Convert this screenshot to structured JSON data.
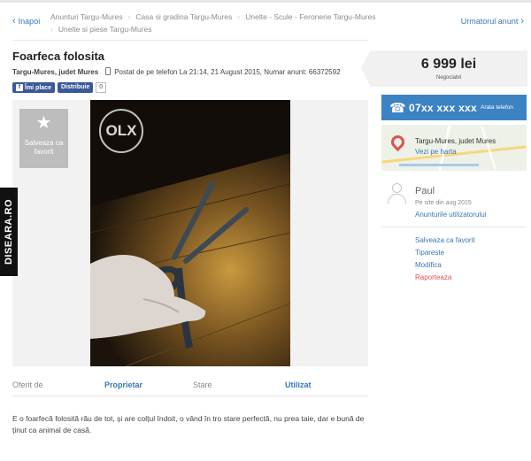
{
  "nav": {
    "back_label": "Inapoi",
    "next_label": "Urmatorul anunt",
    "breadcrumbs": [
      "Anunturi Targu-Mures",
      "Casa si gradina Targu-Mures",
      "Unelte - Scule - Feronerie Targu-Mures",
      "Unelte si piese Targu-Mures"
    ]
  },
  "listing": {
    "title": "Foarfeca folosita",
    "location": "Targu-Mures, judet Mures",
    "posted": "Postat de pe telefon La 21:14, 21 August 2015, Numar anunt: 66372592",
    "like_label": "Îmi place",
    "share_label": "Distribuie",
    "share_count": "0",
    "save_label": "Salveaza ca favorit",
    "photo_logo": "OLX",
    "details": [
      {
        "key": "Oferit de",
        "value": "Proprietar"
      },
      {
        "key": "Stare",
        "value": "Utilizat"
      }
    ],
    "description": "E o foarfecă folosită rău de tot, și are colțul îndoit, o vând în tro stare perfectă, nu prea taie, dar e bună de ținut ca animal de casă."
  },
  "sidebar": {
    "price": "6 999 lei",
    "negotiable": "Negociabil",
    "phone": "07xx xxx xxx",
    "phone_show": "Arata telefon",
    "map_location": "Targu-Mures, judet Mures",
    "map_link": "Vezi pe harta",
    "user_name": "Paul",
    "user_since": "Pe site din aug 2015",
    "user_ads_link": "Anunturile utilizatorului",
    "actions": {
      "save": "Salveaza ca favorit",
      "print": "Tipareste",
      "edit": "Modifica",
      "report": "Raporteaza"
    }
  },
  "watermark": "DISEARA.RO",
  "colors": {
    "link": "#3a77b4",
    "phone_button": "#3c83c4",
    "facebook": "#3b5998",
    "report": "#d9534f"
  }
}
